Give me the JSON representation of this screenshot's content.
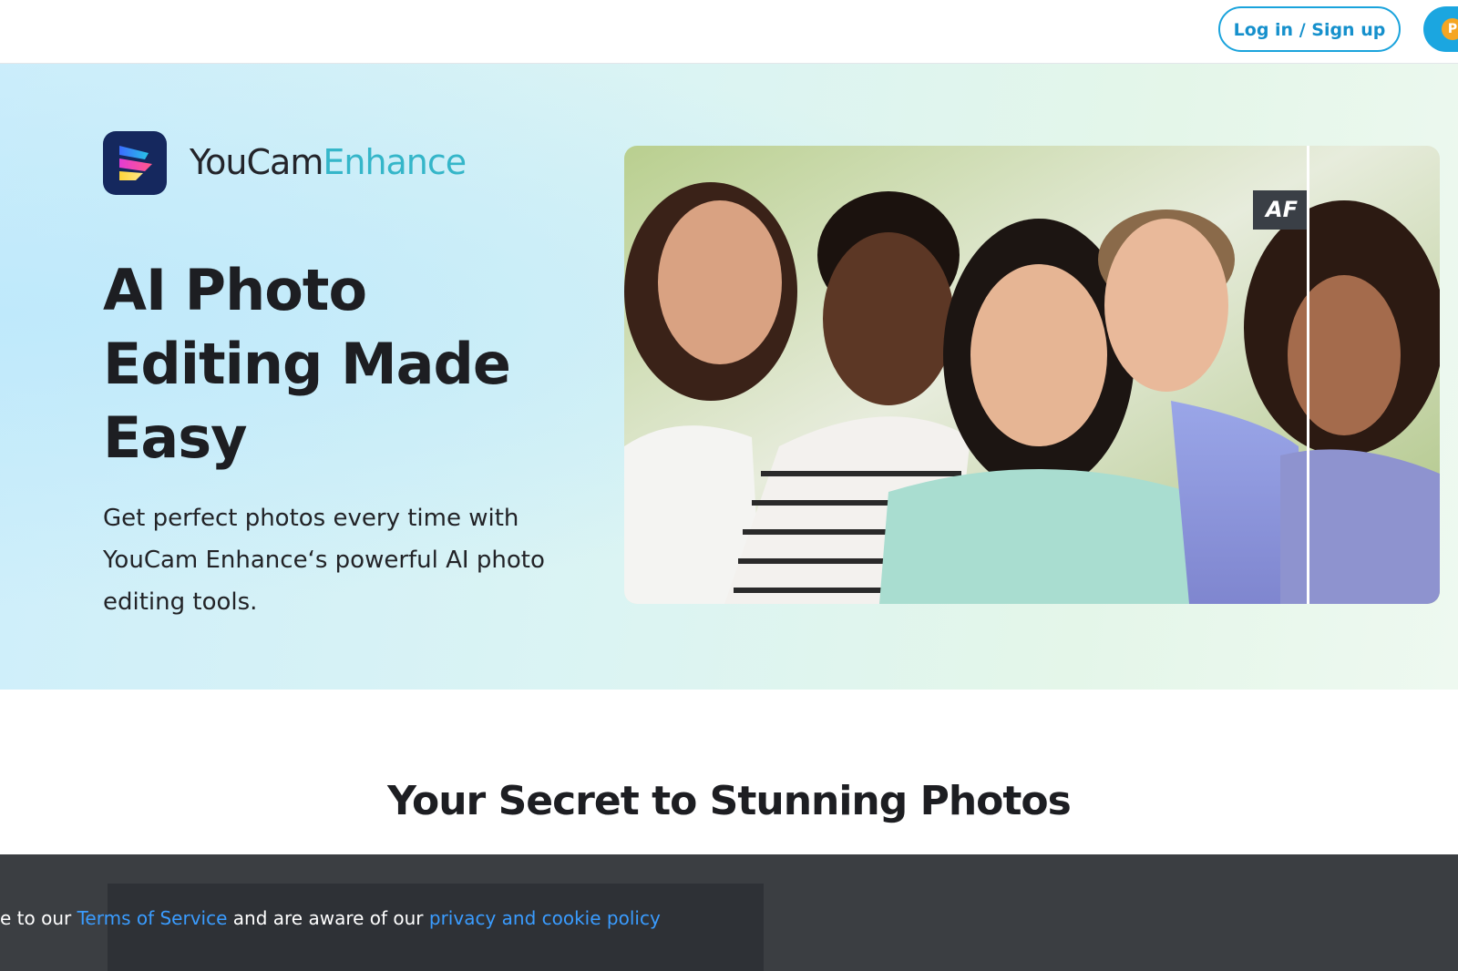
{
  "header": {
    "login_label": "Log in / Sign up",
    "premium_badge_glyph": "P"
  },
  "hero": {
    "brand": {
      "name_part1": "YouCam",
      "name_part2": "Enhance"
    },
    "title": "AI Photo Editing Made Easy",
    "subtitle": "Get perfect photos every time with YouCam Enhance‘s powerful AI photo editing tools.",
    "compare_label": "AF"
  },
  "section": {
    "title": "Your Secret to Stunning Photos"
  },
  "cookie": {
    "text_before": "e to our ",
    "terms_link": "Terms of Service",
    "text_middle": " and are aware of our ",
    "privacy_link": "privacy and cookie policy"
  },
  "colors": {
    "accent": "#1aa3dc",
    "brand_gradient_text": "#35b6c9",
    "link": "#3a9cff"
  },
  "icons": {
    "logo": "youcam-enhance-logo-icon",
    "premium": "premium-crown-icon"
  }
}
